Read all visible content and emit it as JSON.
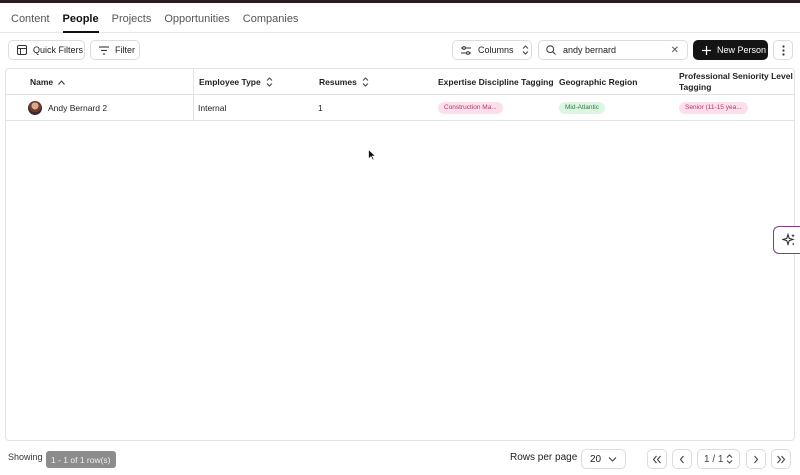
{
  "tabs": [
    {
      "label": "Content",
      "active": false
    },
    {
      "label": "People",
      "active": true
    },
    {
      "label": "Projects",
      "active": false
    },
    {
      "label": "Opportunities",
      "active": false
    },
    {
      "label": "Companies",
      "active": false
    }
  ],
  "toolbar": {
    "quick_filters": "Quick Filters",
    "filter": "Filter",
    "columns": "Columns",
    "search_value": "andy bernard",
    "new_person": "New Person"
  },
  "table": {
    "headers": {
      "name": "Name",
      "employee_type": "Employee Type",
      "resumes": "Resumes",
      "expertise": "Expertise Discipline Tagging",
      "region": "Geographic Region",
      "seniority_line1": "Professional Seniority Level",
      "seniority_line2": "Tagging"
    },
    "rows": [
      {
        "name": "Andy Bernard 2",
        "employee_type": "Internal",
        "resumes": "1",
        "expertise": "Construction Ma...",
        "region": "Mid-Atlantic",
        "seniority": "Senior (11-15 yea..."
      }
    ]
  },
  "footer": {
    "showing_prefix": "Showing",
    "tooltip": "1 - 1 of 1 row(s)",
    "rows_per_page_label": "Rows per page",
    "rows_per_page_value": "20",
    "page_indicator": "1 / 1"
  },
  "colors": {
    "primary_button": "#141414",
    "pill_pink_bg": "#fbe0ec",
    "pill_green_bg": "#dff5e3",
    "ai_accent": "#8a3a8a"
  }
}
